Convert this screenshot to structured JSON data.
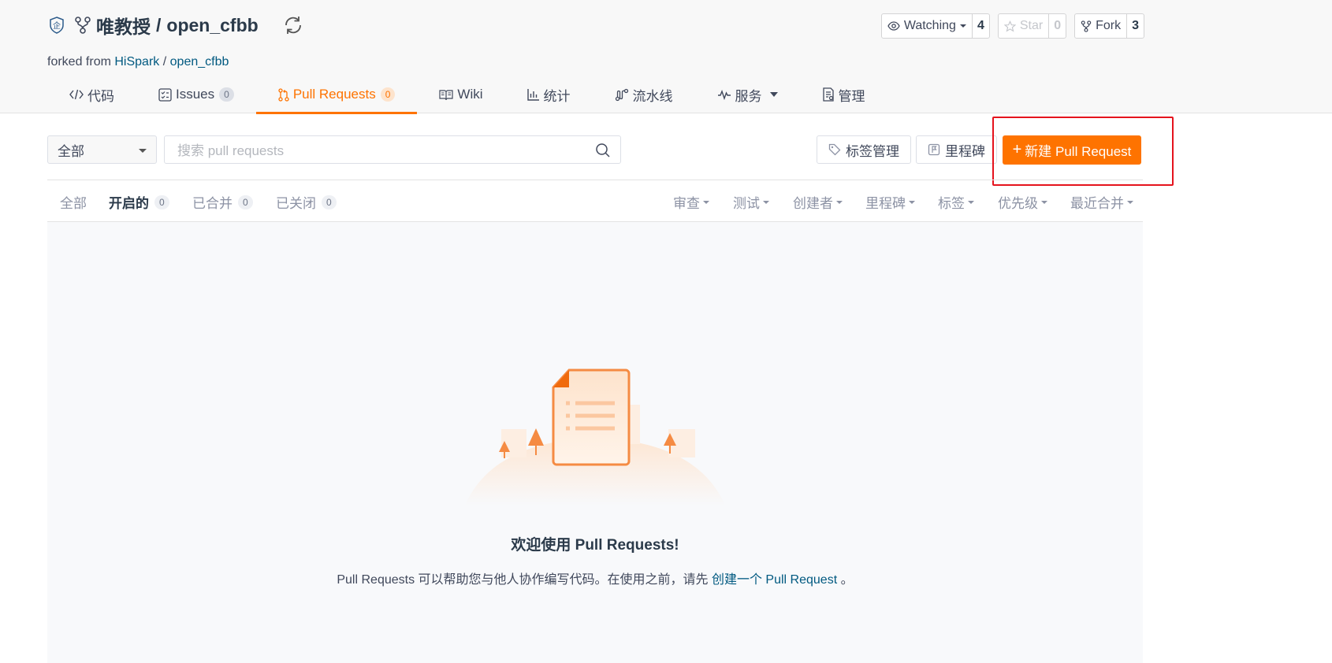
{
  "repo": {
    "owner": "唯教授",
    "separator": "/",
    "name": "open_cfbb",
    "forked_prefix": "forked from",
    "forked_owner": "HiSpark",
    "forked_sep": "/",
    "forked_name": "open_cfbb"
  },
  "actions": {
    "watching_label": "Watching",
    "watching_count": "4",
    "star_label": "Star",
    "star_count": "0",
    "fork_label": "Fork",
    "fork_count": "3"
  },
  "nav": {
    "code": "代码",
    "issues": "Issues",
    "issues_count": "0",
    "pull_requests": "Pull Requests",
    "pr_count": "0",
    "wiki": "Wiki",
    "stats": "统计",
    "pipeline": "流水线",
    "services": "服务",
    "manage": "管理"
  },
  "toolbar": {
    "select_value": "全部",
    "search_placeholder": "搜索 pull requests",
    "labels_btn": "标签管理",
    "milestones_btn": "里程碑",
    "new_pr_plus": "+",
    "new_pr_btn": "新建 Pull Request"
  },
  "filters": {
    "all": "全部",
    "open": "开启的",
    "open_count": "0",
    "merged": "已合并",
    "merged_count": "0",
    "closed": "已关闭",
    "closed_count": "0",
    "review": "审查",
    "test": "测试",
    "creator": "创建者",
    "milestone": "里程碑",
    "label": "标签",
    "priority": "优先级",
    "sort": "最近合并"
  },
  "empty": {
    "title": "欢迎使用 Pull Requests!",
    "desc_before": "Pull Requests 可以帮助您与他人协作编写代码。在使用之前，请先",
    "desc_link": "创建一个 Pull Request",
    "desc_after": "。"
  },
  "colors": {
    "accent": "#fe7300",
    "link": "#005980",
    "annotation": "#e5131d"
  }
}
